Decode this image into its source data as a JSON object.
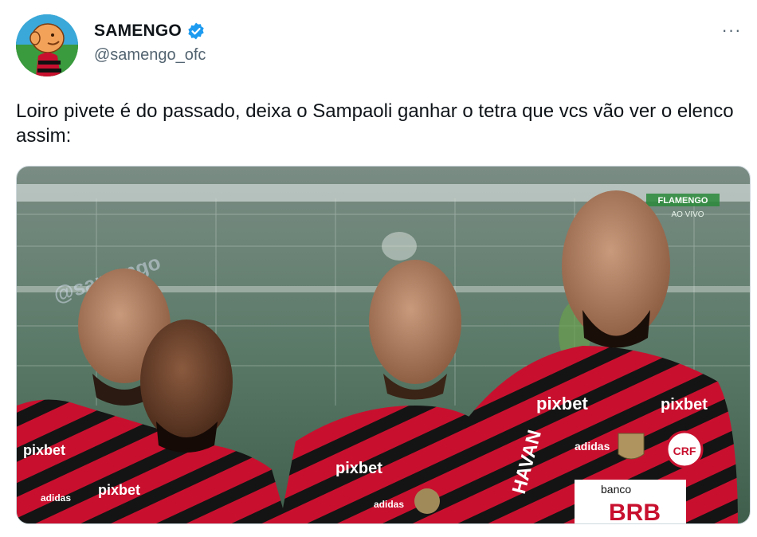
{
  "author": {
    "display_name": "SAMENGO",
    "handle": "@samengo_ofc",
    "verified": true,
    "avatar_icon": "cartoon-avatar-icon",
    "verified_icon": "verified-badge-icon"
  },
  "menu": {
    "more_icon": "more-options-icon",
    "more_label": "···"
  },
  "tweet": {
    "text": "Loiro pivete é do passado, deixa o Sampaoli ganhar o tetra que vcs vão ver o elenco assim:"
  },
  "media": {
    "broadcast_logo": "FLAMENGO",
    "broadcast_live": "AO VIVO",
    "watermark": "@samengo",
    "sponsor_main": "pixbet",
    "sponsor_sleeve": "HAVAN",
    "sponsor_bottom_small": "banco",
    "sponsor_bottom": "BRB",
    "kit_brand": "adidas",
    "crest": "CRF"
  },
  "colors": {
    "text_primary": "#0f1419",
    "text_secondary": "#536471",
    "verified_blue": "#1d9bf0",
    "kit_red": "#c8102e",
    "kit_black": "#111111"
  }
}
